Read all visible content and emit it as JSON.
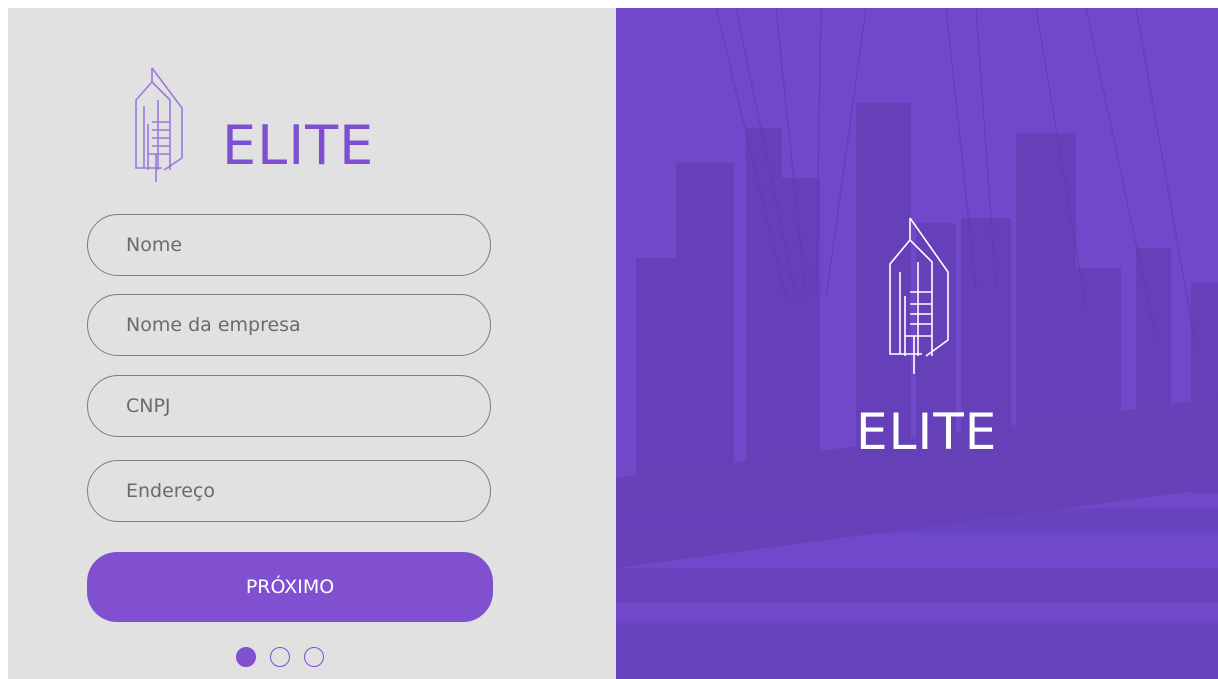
{
  "brand": {
    "name": "ELITE"
  },
  "form": {
    "fields": [
      {
        "placeholder": "Nome"
      },
      {
        "placeholder": "Nome da empresa"
      },
      {
        "placeholder": "CNPJ"
      },
      {
        "placeholder": "Endereço"
      }
    ],
    "next_label": "PRÓXIMO"
  },
  "pagination": {
    "total": 3,
    "current": 1
  },
  "colors": {
    "accent": "#8150d1",
    "left_bg": "#e1e1e1",
    "right_overlay": "#6f4bc6"
  },
  "icons": {
    "logo": "building-logo-icon"
  }
}
